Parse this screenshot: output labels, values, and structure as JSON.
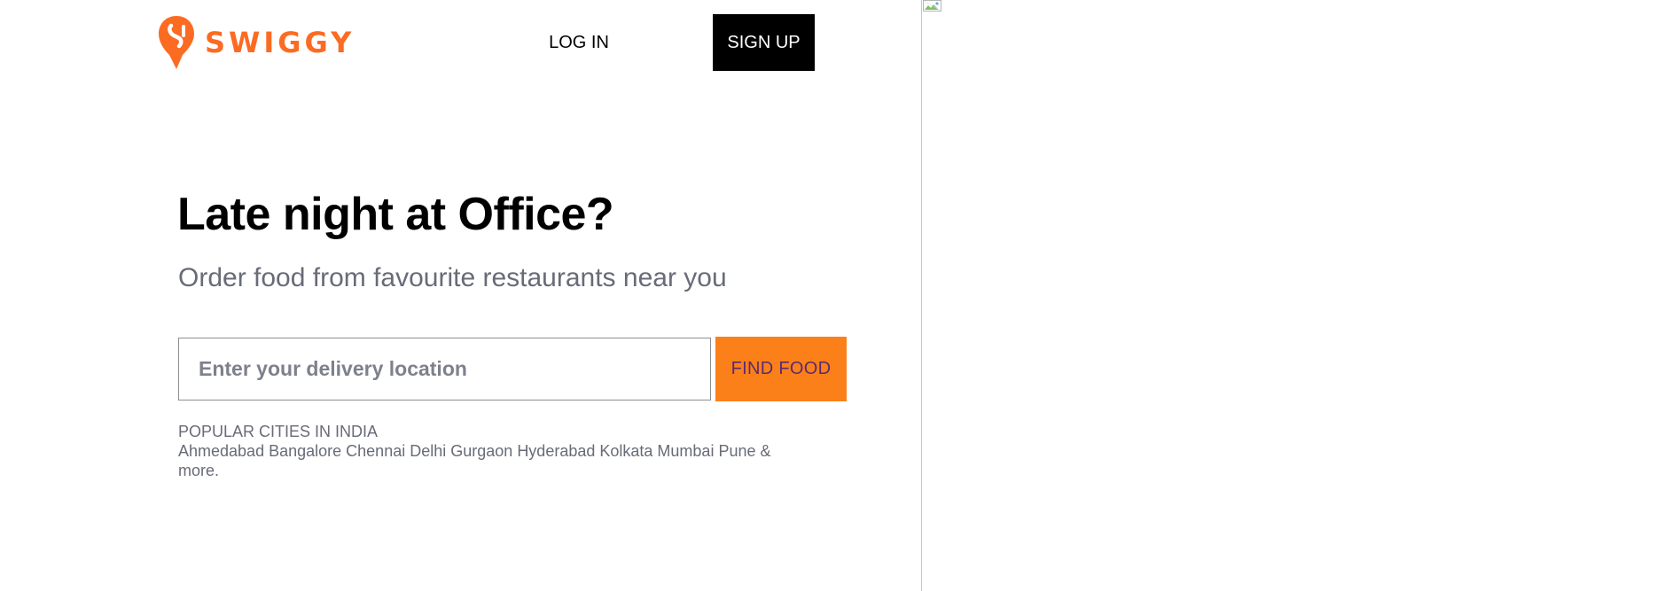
{
  "brand": {
    "name": "SWIGGY",
    "color": "#fc6b22",
    "logo_icon": "swiggy-pin-icon"
  },
  "nav": {
    "login_label": "LOG IN",
    "signup_label": "SIGN UP"
  },
  "hero": {
    "headline": "Late night at Office?",
    "subheadline": "Order food from favourite restaurants near you"
  },
  "search": {
    "placeholder": "Enter your delivery location",
    "value": "",
    "button_label": "FIND FOOD",
    "button_color": "#fc8019"
  },
  "cities": {
    "title": "POPULAR CITIES IN INDIA",
    "items": [
      "Ahmedabad",
      "Bangalore",
      "Chennai",
      "Delhi",
      "Gurgaon",
      "Hyderabad",
      "Kolkata",
      "Mumbai",
      "Pune"
    ],
    "more_label": "& more."
  },
  "banner": {
    "image_icon": "broken-image-icon"
  }
}
